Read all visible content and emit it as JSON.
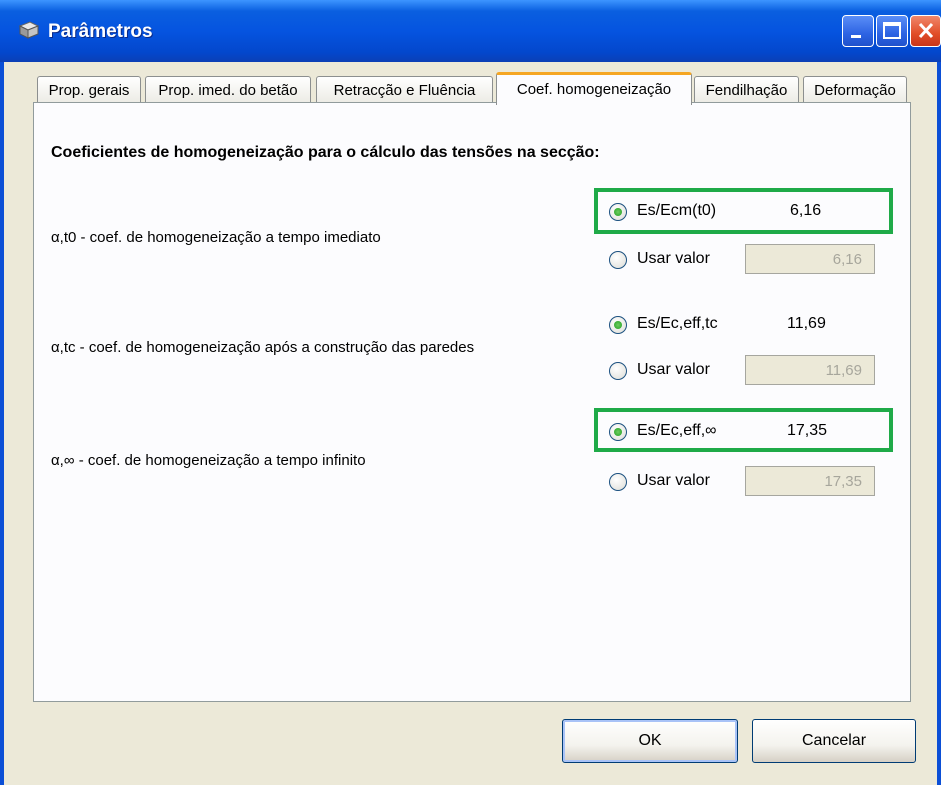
{
  "window": {
    "title": "Parâmetros"
  },
  "tabs": [
    {
      "label": "Prop. gerais"
    },
    {
      "label": "Prop. imed. do betão"
    },
    {
      "label": "Retracção e Fluência"
    },
    {
      "label": "Coef. homogeneização"
    },
    {
      "label": "Fendilhação"
    },
    {
      "label": "Deformação"
    }
  ],
  "active_tab": "Coef. homogeneização",
  "heading": "Coeficientes de homogeneização para o cálculo das tensões na secção:",
  "rows": [
    {
      "label": "α,t0 - coef. de homogeneização a tempo imediato",
      "option_a": {
        "label": "Es/Ecm(t0)",
        "value": "6,16",
        "selected": true
      },
      "option_b": {
        "label": "Usar valor",
        "value": "6,16",
        "selected": false
      }
    },
    {
      "label": "α,tc - coef. de homogeneização após a construção das paredes",
      "option_a": {
        "label": "Es/Ec,eff,tc",
        "value": "11,69",
        "selected": true
      },
      "option_b": {
        "label": "Usar valor",
        "value": "11,69",
        "selected": false
      }
    },
    {
      "label": "α,∞ - coef. de homogeneização a tempo infinito",
      "option_a": {
        "label": "Es/Ec,eff,∞",
        "value": "17,35",
        "selected": true
      },
      "option_b": {
        "label": "Usar valor",
        "value": "17,35",
        "selected": false
      }
    }
  ],
  "buttons": {
    "ok": "OK",
    "cancel": "Cancelar"
  },
  "colors": {
    "highlight": "#1faa48",
    "tab_accent": "#f5a623",
    "titlebar": "#0554e0"
  }
}
